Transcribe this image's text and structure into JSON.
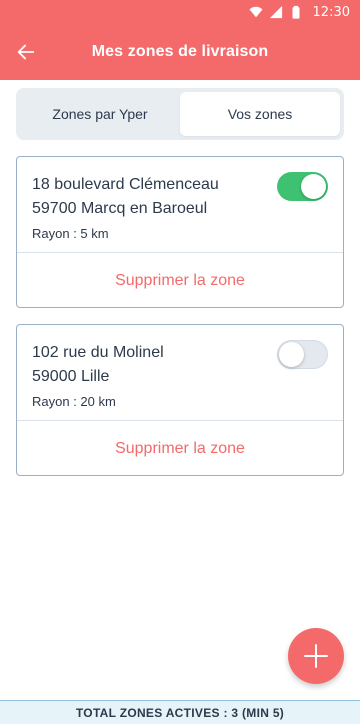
{
  "status_bar": {
    "time": "12:30",
    "icons": [
      "wifi-icon",
      "signal-icon",
      "battery-icon"
    ],
    "background": "#f46a6a"
  },
  "app_bar": {
    "title": "Mes zones de livraison",
    "back_icon": "arrow-left-icon",
    "background": "#f46a6a"
  },
  "tabs": {
    "items": [
      {
        "label": "Zones par Yper",
        "active": false
      },
      {
        "label": "Vos zones",
        "active": true
      }
    ]
  },
  "zones": [
    {
      "address_line1": "18 boulevard Clémenceau",
      "address_line2": "59700 Marcq en Baroeul",
      "radius": "Rayon : 5 km",
      "enabled": true,
      "delete_label": "Supprimer la zone"
    },
    {
      "address_line1": "102 rue du Molinel",
      "address_line2": "59000 Lille",
      "radius": "Rayon : 20 km",
      "enabled": false,
      "delete_label": "Supprimer la zone"
    }
  ],
  "fab": {
    "icon": "plus-icon"
  },
  "footer": {
    "text": "TOTAL ZONES ACTIVES : 3 (MIN 5)"
  },
  "colors": {
    "accent": "#f46a6a",
    "toggle_on": "#3ec271",
    "toggle_off": "#e4e9ef",
    "card_border": "#9bb0c6",
    "text": "#2c3a4b",
    "footer_bg": "#e6f3f8"
  }
}
